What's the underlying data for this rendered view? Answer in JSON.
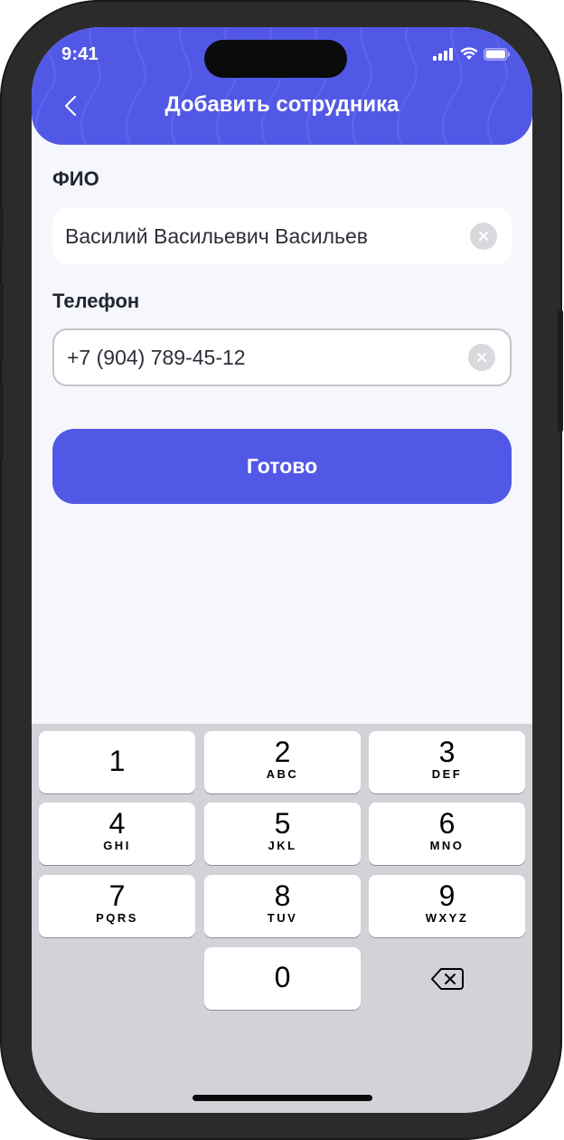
{
  "status_bar": {
    "time": "9:41"
  },
  "header": {
    "title": "Добавить сотрудника",
    "back_icon": "chevron-left-icon"
  },
  "form": {
    "name_label": "ФИО",
    "name_value": "Василий Васильевич Васильев",
    "phone_label": "Телефон",
    "phone_value": "+7 (904) 789-45-12",
    "clear_icon": "clear-circle-icon"
  },
  "actions": {
    "done_label": "Готово"
  },
  "keyboard": {
    "keys": [
      {
        "digit": "1",
        "letters": ""
      },
      {
        "digit": "2",
        "letters": "ABC"
      },
      {
        "digit": "3",
        "letters": "DEF"
      },
      {
        "digit": "4",
        "letters": "GHI"
      },
      {
        "digit": "5",
        "letters": "JKL"
      },
      {
        "digit": "6",
        "letters": "MNO"
      },
      {
        "digit": "7",
        "letters": "PQRS"
      },
      {
        "digit": "8",
        "letters": "TUV"
      },
      {
        "digit": "9",
        "letters": "WXYZ"
      },
      {
        "digit": "0",
        "letters": ""
      }
    ],
    "backspace_icon": "backspace-icon"
  },
  "colors": {
    "accent": "#5258e6",
    "background": "#f5f7fd",
    "keyboard_bg": "#d1d3d9",
    "frame": "#2b2b2b"
  }
}
